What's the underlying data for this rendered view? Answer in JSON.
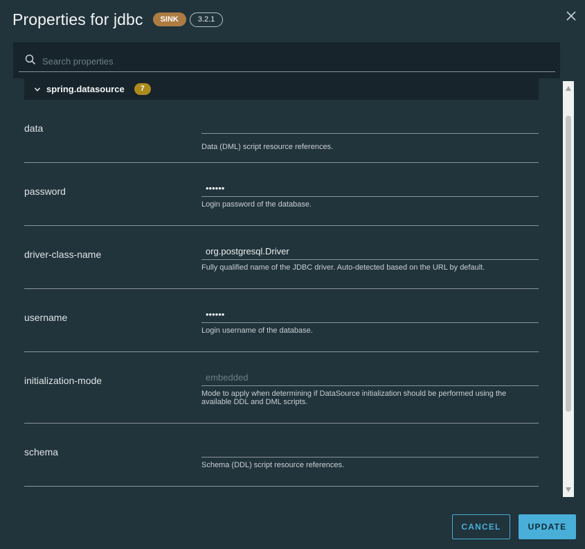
{
  "dialog": {
    "title": "Properties for jdbc",
    "type_badge": "SINK",
    "version_badge": "3.2.1"
  },
  "search": {
    "placeholder": "Search properties"
  },
  "group": {
    "name": "spring.datasource",
    "count": "7"
  },
  "properties": [
    {
      "name": "data",
      "value": "",
      "placeholder": "",
      "description": "Data (DML) script resource references."
    },
    {
      "name": "password",
      "value": "••••••",
      "placeholder": "",
      "description": "Login password of the database."
    },
    {
      "name": "driver-class-name",
      "value": "org.postgresql.Driver",
      "placeholder": "",
      "description": "Fully qualified name of the JDBC driver. Auto-detected based on the URL by default."
    },
    {
      "name": "username",
      "value": "••••••",
      "placeholder": "",
      "description": "Login username of the database."
    },
    {
      "name": "initialization-mode",
      "value": "",
      "placeholder": "embedded",
      "description": "Mode to apply when determining if DataSource initialization should be performed using the available DDL and DML scripts."
    },
    {
      "name": "schema",
      "value": "",
      "placeholder": "",
      "description": "Schema (DDL) script resource references."
    }
  ],
  "footer": {
    "cancel_label": "CANCEL",
    "update_label": "UPDATE"
  },
  "colors": {
    "background": "#21333b",
    "panel": "#17242b",
    "accent": "#49afd9",
    "sink_badge": "#ad7c43",
    "count_badge": "#ad8a1c"
  },
  "icons": {
    "close": "close-icon",
    "search": "search-icon",
    "group_toggle": "chevron-down-icon"
  }
}
